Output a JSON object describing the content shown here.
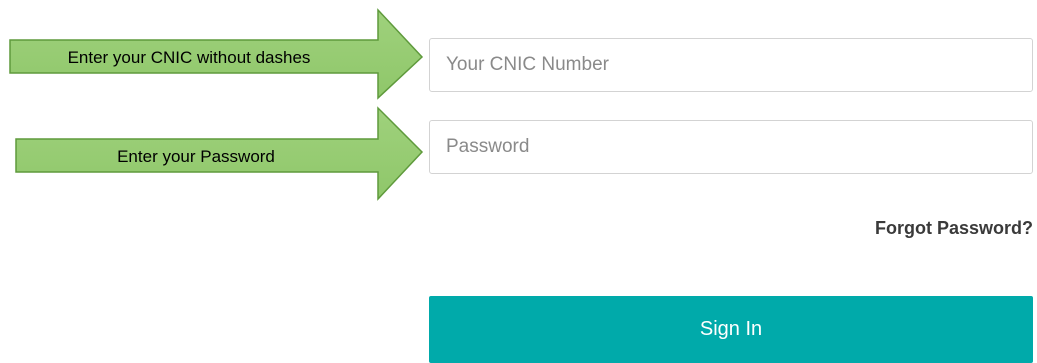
{
  "form": {
    "cnic_placeholder": "Your CNIC Number",
    "password_placeholder": "Password",
    "forgot_password": "Forgot Password?",
    "sign_in": "Sign In"
  },
  "annotations": [
    {
      "text": "Enter your CNIC without dashes"
    },
    {
      "text": "Enter your Password"
    }
  ],
  "colors": {
    "sign_in_button": "#00aaaa",
    "arrow_fill": "#9fd17c",
    "arrow_stroke": "#5f9a3c",
    "field_border": "#d3d3d3"
  }
}
